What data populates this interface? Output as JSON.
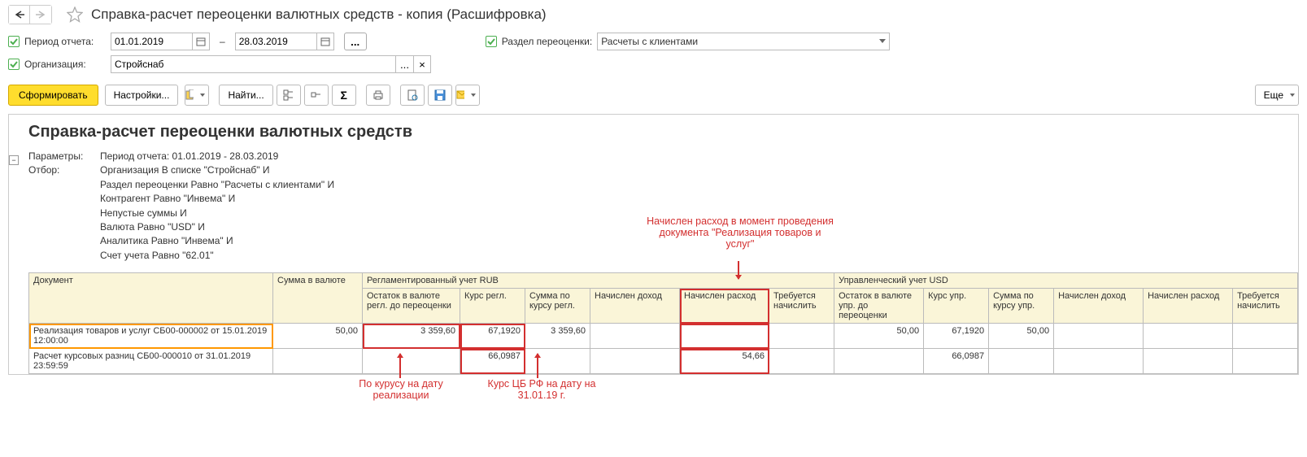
{
  "page_title": "Справка-расчет переоценки валютных средств - копия (Расшифровка)",
  "params": {
    "period_label": "Период отчета:",
    "date_from": "01.01.2019",
    "date_to": "28.03.2019",
    "section_label": "Раздел переоценки:",
    "section_value": "Расчеты с клиентами",
    "org_label": "Организация:",
    "org_value": "Стройснаб"
  },
  "toolbar": {
    "form": "Сформировать",
    "settings": "Настройки...",
    "find": "Найти...",
    "more": "Еще"
  },
  "report": {
    "title": "Справка-расчет переоценки валютных средств",
    "param_label": "Параметры:",
    "param_value": "Период отчета: 01.01.2019 - 28.03.2019",
    "filter_label": "Отбор:",
    "filters": [
      "Организация В списке \"Стройснаб\" И",
      "Раздел переоценки Равно \"Расчеты с клиентами\" И",
      "Контрагент Равно \"Инвема\" И",
      "Непустые суммы И",
      "Валюта Равно \"USD\" И",
      "Аналитика Равно \"Инвема\" И",
      "Счет учета Равно \"62.01\""
    ]
  },
  "annotations": {
    "top": "Начислен расход в момент проведения документа \"Реализация товаров и услуг\"",
    "b1": "По курусу на дату реализации",
    "b2": "Курс ЦБ РФ на дату на 31.01.19 г."
  },
  "table": {
    "headers": {
      "doc": "Документ",
      "sum_cur": "Сумма в валюте",
      "reg_group": "Регламентированный учет RUB",
      "mgmt_group": "Управленческий учет USD",
      "bal_reg": "Остаток в валюте регл. до переоценки",
      "rate_reg": "Курс регл.",
      "sum_reg": "Сумма по курсу регл.",
      "income": "Начислен доход",
      "expense": "Начислен расход",
      "to_accrue": "Требуется начислить",
      "bal_mgmt": "Остаток в валюте упр. до переоценки",
      "rate_mgmt": "Курс упр.",
      "sum_mgmt": "Сумма по курсу упр."
    },
    "rows": [
      {
        "doc": "Реализация товаров и услуг СБ00-000002 от 15.01.2019 12:00:00",
        "sum_cur": "50,00",
        "bal_reg": "3 359,60",
        "rate_reg": "67,1920",
        "sum_reg": "3 359,60",
        "income_reg": "",
        "expense_reg": "",
        "accrue_reg": "",
        "bal_mgmt": "50,00",
        "rate_mgmt": "67,1920",
        "sum_mgmt": "50,00",
        "income_mgmt": "",
        "expense_mgmt": "",
        "accrue_mgmt": ""
      },
      {
        "doc": "Расчет курсовых разниц СБ00-000010 от 31.01.2019 23:59:59",
        "sum_cur": "",
        "bal_reg": "",
        "rate_reg": "66,0987",
        "sum_reg": "",
        "income_reg": "",
        "expense_reg": "54,66",
        "accrue_reg": "",
        "bal_mgmt": "",
        "rate_mgmt": "66,0987",
        "sum_mgmt": "",
        "income_mgmt": "",
        "expense_mgmt": "",
        "accrue_mgmt": ""
      }
    ]
  }
}
